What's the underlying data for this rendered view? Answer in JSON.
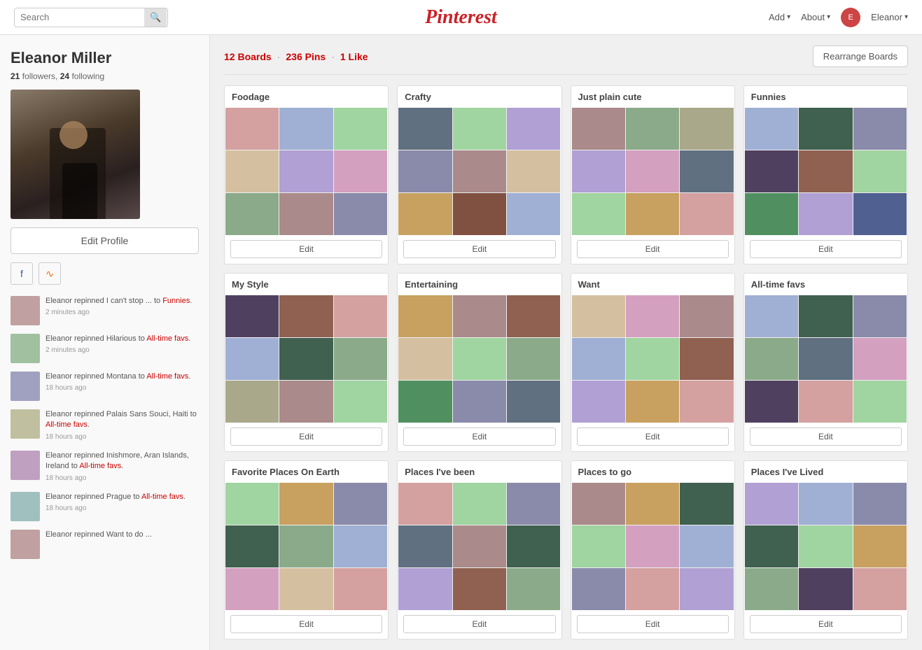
{
  "header": {
    "search_placeholder": "Search",
    "logo": "Pinterest",
    "add_label": "Add",
    "about_label": "About",
    "user_label": "Eleanor"
  },
  "sidebar": {
    "user_name": "Eleanor Miller",
    "followers": "21",
    "following": "24",
    "followers_label": "followers,",
    "following_label": "following",
    "edit_profile_label": "Edit Profile",
    "social": {
      "facebook_icon": "f",
      "rss_icon": "rss"
    },
    "activity": [
      {
        "text_before": "Eleanor repinned I can't stop ... to ",
        "board_link": "Funnies",
        "text_after": ".",
        "time": "2 minutes ago",
        "thumb_color": "at1"
      },
      {
        "text_before": "Eleanor repinned Hilarious to ",
        "board_link": "All-time favs",
        "text_after": ".",
        "time": "2 minutes ago",
        "thumb_color": "at2"
      },
      {
        "text_before": "Eleanor repinned Montana to ",
        "board_link": "All-time favs",
        "text_after": ".",
        "time": "18 hours ago",
        "thumb_color": "at3"
      },
      {
        "text_before": "Eleanor repinned Palais Sans Souci, Haiti to ",
        "board_link": "All-time favs",
        "text_after": ".",
        "time": "18 hours ago",
        "thumb_color": "at4"
      },
      {
        "text_before": "Eleanor repinned Inishmore, Aran Islands, Ireland to ",
        "board_link": "All-time favs",
        "text_after": ".",
        "time": "18 hours ago",
        "thumb_color": "at5"
      },
      {
        "text_before": "Eleanor repinned Prague to ",
        "board_link": "All-time favs",
        "text_after": ".",
        "time": "18 hours ago",
        "thumb_color": "at6"
      },
      {
        "text_before": "Eleanor repinned Want to do ...",
        "board_link": "",
        "text_after": "",
        "time": "",
        "thumb_color": "at1"
      }
    ]
  },
  "main": {
    "boards_count": "12 Boards",
    "pins_count": "236 Pins",
    "likes_count": "1 Like",
    "dot": "·",
    "rearrange_label": "Rearrange Boards",
    "boards": [
      {
        "title": "Foodage",
        "edit_label": "Edit",
        "colors": [
          "c1",
          "c2",
          "c3",
          "c4",
          "c5",
          "c6",
          "c7",
          "c8",
          "c9"
        ]
      },
      {
        "title": "Crafty",
        "edit_label": "Edit",
        "colors": [
          "c12",
          "c3",
          "c5",
          "c9",
          "c8",
          "c4",
          "c11",
          "c13",
          "c2"
        ]
      },
      {
        "title": "Just plain cute",
        "edit_label": "Edit",
        "colors": [
          "c8",
          "c7",
          "c10",
          "c5",
          "c6",
          "c12",
          "c3",
          "c11",
          "c1"
        ]
      },
      {
        "title": "Funnies",
        "edit_label": "Edit",
        "colors": [
          "c2",
          "c14",
          "c9",
          "c15",
          "c16",
          "c3",
          "c17",
          "c5",
          "c18"
        ]
      },
      {
        "title": "My Style",
        "edit_label": "Edit",
        "colors": [
          "c15",
          "c16",
          "c1",
          "c2",
          "c14",
          "c7",
          "c10",
          "c8",
          "c3"
        ]
      },
      {
        "title": "Entertaining",
        "edit_label": "Edit",
        "colors": [
          "c11",
          "c8",
          "c16",
          "c4",
          "c3",
          "c7",
          "c17",
          "c9",
          "c12"
        ]
      },
      {
        "title": "Want",
        "edit_label": "Edit",
        "colors": [
          "c4",
          "c6",
          "c8",
          "c2",
          "c3",
          "c16",
          "c5",
          "c11",
          "c1"
        ]
      },
      {
        "title": "All-time favs",
        "edit_label": "Edit",
        "colors": [
          "c2",
          "c14",
          "c9",
          "c7",
          "c12",
          "c6",
          "c15",
          "c1",
          "c3"
        ]
      },
      {
        "title": "Favorite Places On Earth",
        "edit_label": "Edit",
        "colors": [
          "c3",
          "c11",
          "c9",
          "c14",
          "c7",
          "c2",
          "c6",
          "c4",
          "c1"
        ]
      },
      {
        "title": "Places I've been",
        "edit_label": "Edit",
        "colors": [
          "c1",
          "c3",
          "c9",
          "c12",
          "c8",
          "c14",
          "c5",
          "c16",
          "c7"
        ]
      },
      {
        "title": "Places to go",
        "edit_label": "Edit",
        "colors": [
          "c8",
          "c11",
          "c14",
          "c3",
          "c6",
          "c2",
          "c9",
          "c1",
          "c5"
        ]
      },
      {
        "title": "Places I've Lived",
        "edit_label": "Edit",
        "colors": [
          "c5",
          "c2",
          "c9",
          "c14",
          "c3",
          "c11",
          "c7",
          "c15",
          "c1"
        ]
      }
    ]
  }
}
